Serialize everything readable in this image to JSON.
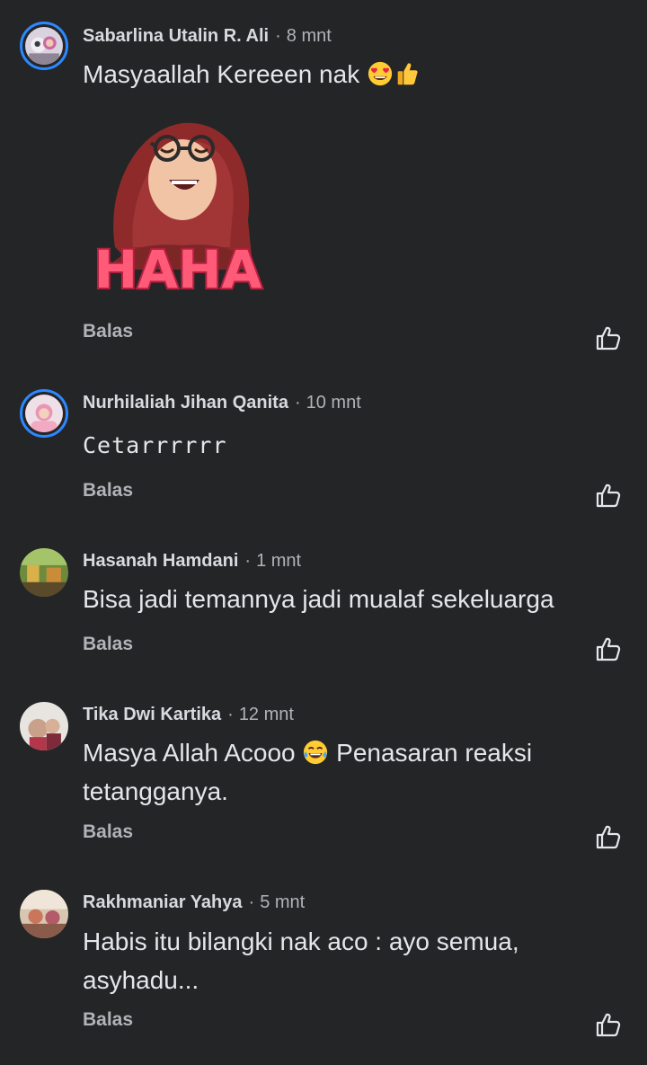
{
  "reply_label": "Balas",
  "comments": [
    {
      "author": "Sabarlina Utalin R. Ali",
      "time": "8 mnt",
      "text": "Masyaallah Kereeen nak",
      "emojis": [
        "heart-eyes-emoji",
        "thumbs-up-emoji"
      ],
      "sticker": {
        "caption": "HAHA",
        "description": "hijab-girl-laughing-sticker"
      },
      "avatar_story_ring": true
    },
    {
      "author": "Nurhilaliah Jihan Qanita",
      "time": "10 mnt",
      "text": "Cetarrrrrr",
      "avatar_story_ring": true
    },
    {
      "author": "Hasanah Hamdani",
      "time": "1 mnt",
      "text": "Bisa jadi temannya jadi mualaf sekeluarga",
      "avatar_story_ring": false
    },
    {
      "author": "Tika Dwi Kartika",
      "time": "12 mnt",
      "text_before_emoji": "Masya Allah Acooo",
      "emoji": "tears-of-joy-emoji",
      "text_after_emoji": "Penasaran reaksi tetangganya.",
      "avatar_story_ring": false
    },
    {
      "author": "Rakhmaniar Yahya",
      "time": "5 mnt",
      "text": "Habis itu bilangki nak aco : ayo semua, asyhadu...",
      "avatar_story_ring": false
    }
  ],
  "colors": {
    "background": "#242526",
    "text_primary": "#e4e6eb",
    "text_secondary": "#b0b3b8",
    "story_ring": "#2d88ff",
    "sticker_text": "#ff5a78"
  },
  "icons": {
    "like": "thumbs-up-outline-icon"
  }
}
